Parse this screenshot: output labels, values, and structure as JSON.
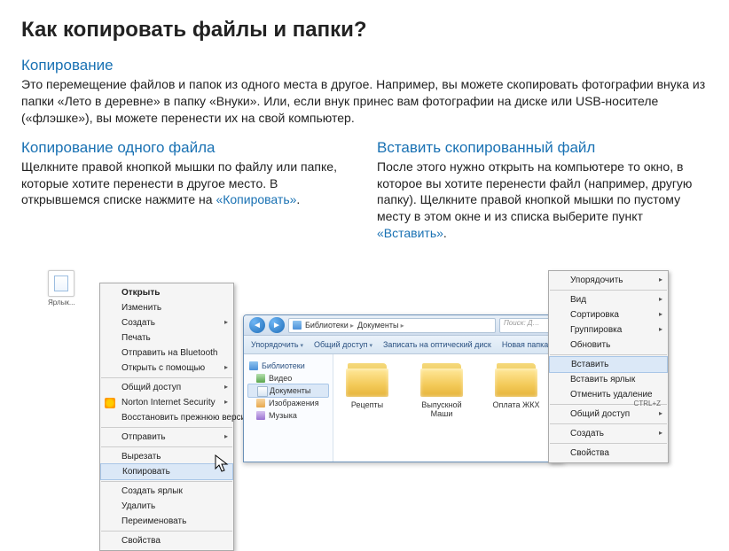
{
  "title": "Как копировать файлы и папки?",
  "section1": {
    "heading": "Копирование",
    "text": "Это перемещение файлов и папок из одного места в другое. Например, вы можете скопировать фотографии внука из папки «Лето в деревне» в папку «Внуки». Или, если внук принес вам фотографии на диске или USB-носителе («флэшке»), вы можете перенести их на свой компьютер."
  },
  "left_col": {
    "heading": "Копирование одного файла",
    "text_before": "Щелкните правой кнопкой мышки по файлу или папке, которые хотите перенести в другое место. В открывшемся списке нажмите на ",
    "action": "«Копировать»",
    "text_after": "."
  },
  "right_col": {
    "heading": "Вставить скопированный файл",
    "text_before": "После этого нужно открыть на компьютере то окно, в которое вы хотите перенести файл (например, другую папку). Щелкните правой кнопкой мышки по пустому месту в этом окне и из списка выберите пункт ",
    "action": "«Вставить»",
    "text_after": "."
  },
  "desktop_icon_label": "Ярлык...",
  "ctx_menu_left": {
    "items": [
      {
        "label": "Открыть",
        "bold": true
      },
      {
        "label": "Изменить"
      },
      {
        "label": "Создать",
        "arrow": true
      },
      {
        "label": "Печать"
      },
      {
        "label": "Отправить на Bluetooth"
      },
      {
        "label": "Открыть с помощью",
        "arrow": true
      },
      {
        "sep": true
      },
      {
        "label": "Общий доступ",
        "arrow": true
      },
      {
        "label": "Norton Internet Security",
        "arrow": true,
        "icon": "shield"
      },
      {
        "label": "Восстановить прежнюю версию"
      },
      {
        "sep": true
      },
      {
        "label": "Отправить",
        "arrow": true
      },
      {
        "sep": true
      },
      {
        "label": "Вырезать"
      },
      {
        "label": "Копировать",
        "highlighted": true
      },
      {
        "sep": true
      },
      {
        "label": "Создать ярлык"
      },
      {
        "label": "Удалить"
      },
      {
        "label": "Переименовать"
      },
      {
        "sep": true
      },
      {
        "label": "Свойства"
      }
    ]
  },
  "explorer": {
    "breadcrumbs": [
      "Библиотеки",
      "Документы"
    ],
    "search_placeholder": "Поиск: Д…",
    "toolbar": [
      "Упорядочить",
      "Общий доступ",
      "Записать на оптический диск",
      "Новая папка"
    ],
    "sidebar": {
      "header": "Библиотеки",
      "items": [
        {
          "label": "Видео",
          "icon": "ic-vid"
        },
        {
          "label": "Документы",
          "icon": "ic-doc",
          "active": true
        },
        {
          "label": "Изображения",
          "icon": "ic-img"
        },
        {
          "label": "Музыка",
          "icon": "ic-mus"
        }
      ]
    },
    "folders": [
      {
        "label": "Рецепты"
      },
      {
        "label": "Выпускной Маши"
      },
      {
        "label": "Оплата ЖКХ"
      }
    ]
  },
  "ctx_menu_right": {
    "items": [
      {
        "label": "Упорядочить",
        "arrow": true
      },
      {
        "sep": true
      },
      {
        "label": "Вид",
        "arrow": true
      },
      {
        "label": "Сортировка",
        "arrow": true
      },
      {
        "label": "Группировка",
        "arrow": true
      },
      {
        "label": "Обновить"
      },
      {
        "sep": true
      },
      {
        "label": "Вставить",
        "highlighted": true
      },
      {
        "label": "Вставить ярлык"
      },
      {
        "label": "Отменить удаление",
        "shortcut": "CTRL+Z"
      },
      {
        "sep": true
      },
      {
        "label": "Общий доступ",
        "arrow": true
      },
      {
        "sep": true
      },
      {
        "label": "Создать",
        "arrow": true
      },
      {
        "sep": true
      },
      {
        "label": "Свойства"
      }
    ]
  }
}
